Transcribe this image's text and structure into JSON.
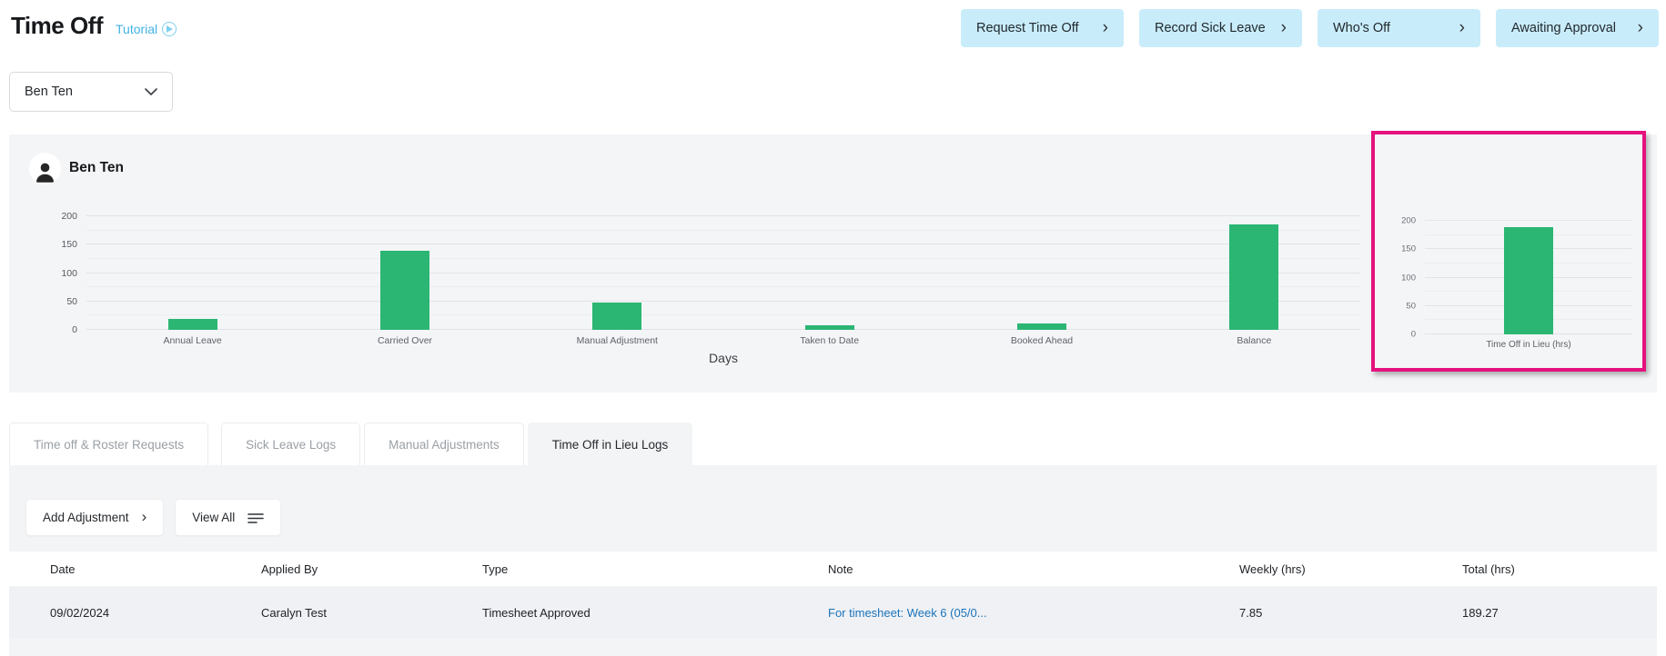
{
  "page": {
    "title": "Time Off",
    "tutorial_label": "Tutorial"
  },
  "header_actions": [
    {
      "label": "Request Time Off"
    },
    {
      "label": "Record Sick Leave"
    },
    {
      "label": "Who's Off"
    },
    {
      "label": "Awaiting Approval"
    }
  ],
  "employee_select": {
    "value": "Ben Ten"
  },
  "summary": {
    "employee_name": "Ben Ten"
  },
  "chart_data": [
    {
      "type": "bar",
      "title": "",
      "categories": [
        "Annual Leave",
        "Carried Over",
        "Manual Adjustment",
        "Taken to Date",
        "Booked Ahead",
        "Balance"
      ],
      "values": [
        18.5,
        139,
        48,
        8,
        11,
        185
      ],
      "xlabel": "Days",
      "ylabel": "",
      "ylim": [
        0,
        200
      ],
      "yticks": [
        0,
        50,
        100,
        150,
        200
      ],
      "grid": true,
      "legend": "none",
      "bar_color": "#2bb673"
    },
    {
      "type": "bar",
      "title": "",
      "categories": [
        "Time Off in Lieu (hrs)"
      ],
      "values": [
        189.27
      ],
      "xlabel": "",
      "ylabel": "",
      "ylim": [
        0,
        200
      ],
      "yticks": [
        0,
        50,
        100,
        150,
        200
      ],
      "grid": true,
      "legend": "none",
      "bar_color": "#2bb673",
      "highlight_border_color": "#e5127d"
    }
  ],
  "tabs": [
    {
      "label": "Time off & Roster Requests",
      "active": false
    },
    {
      "label": "Sick Leave Logs",
      "active": false
    },
    {
      "label": "Manual Adjustments",
      "active": false
    },
    {
      "label": "Time Off in Lieu Logs",
      "active": true
    }
  ],
  "toolbar": {
    "add_adjustment_label": "Add Adjustment",
    "view_all_label": "View All"
  },
  "table": {
    "columns": [
      "Date",
      "Applied By",
      "Type",
      "Note",
      "Weekly (hrs)",
      "Total (hrs)"
    ],
    "rows": [
      {
        "date": "09/02/2024",
        "applied_by": "Caralyn Test",
        "type": "Timesheet Approved",
        "note": "For timesheet: Week 6 (05/0...",
        "weekly_hrs": "7.85",
        "total_hrs": "189.27"
      }
    ]
  },
  "colors": {
    "accent_blue": "#c9ecfa",
    "link_blue": "#1b74bb",
    "tutorial_blue": "#41b2e5",
    "bar_green": "#2bb673",
    "highlight_pink": "#e5127d",
    "panel_gray": "#f4f5f7"
  }
}
